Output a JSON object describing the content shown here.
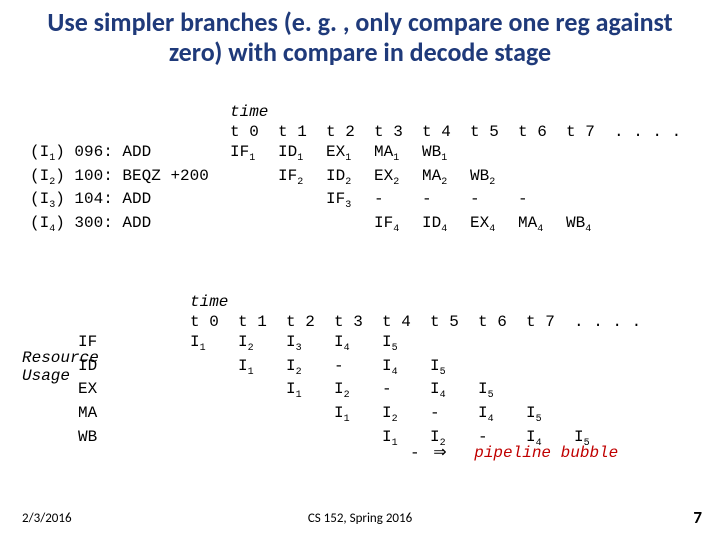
{
  "title": "Use simpler branches (e. g. , only compare one reg against zero) with compare in decode stage",
  "pipeline": {
    "time_label": "time",
    "headers": [
      "t 0",
      "t 1",
      "t 2",
      "t 3",
      "t 4",
      "t 5",
      "t 6",
      "t 7",
      ". . . ."
    ],
    "rows": [
      {
        "instr": "(I",
        "sub": "1",
        "rest": ") 096: ADD",
        "cells": [
          "IF",
          "ID",
          "EX",
          "MA",
          "WB",
          "",
          "",
          ""
        ],
        "subs": [
          "1",
          "1",
          "1",
          "1",
          "1",
          "",
          "",
          ""
        ]
      },
      {
        "instr": "(I",
        "sub": "2",
        "rest": ") 100: BEQZ +200",
        "cells": [
          "",
          "IF",
          "ID",
          "EX",
          "MA",
          "WB",
          "",
          ""
        ],
        "subs": [
          "",
          "2",
          "2",
          "2",
          "2",
          "2",
          "",
          ""
        ]
      },
      {
        "instr": "(I",
        "sub": "3",
        "rest": ") 104: ADD",
        "cells": [
          "",
          "",
          "IF",
          "-",
          "-",
          "-",
          "-",
          ""
        ],
        "subs": [
          "",
          "",
          "3",
          "",
          "",
          "",
          "",
          ""
        ]
      },
      {
        "instr": "(I",
        "sub": "4",
        "rest": ") 300: ADD",
        "cells": [
          "",
          "",
          "",
          "IF",
          "ID",
          "EX",
          "MA",
          "WB"
        ],
        "subs": [
          "",
          "",
          "",
          "4",
          "4",
          "4",
          "4",
          "4"
        ]
      }
    ]
  },
  "resource": {
    "time_label": "time",
    "headers": [
      "t 0",
      "t 1",
      "t 2",
      "t 3",
      "t 4",
      "t 5",
      "t 6",
      "t 7",
      ". . . ."
    ],
    "label": "Resource\nUsage",
    "stages": [
      "IF",
      "ID",
      "EX",
      "MA",
      "WB"
    ],
    "grid": [
      [
        "I",
        "I",
        "I",
        "I",
        "I",
        "",
        "",
        ""
      ],
      [
        "",
        "I",
        "I",
        "-",
        "I",
        "I",
        "",
        ""
      ],
      [
        "",
        "",
        "I",
        "I",
        "-",
        "I",
        "I",
        ""
      ],
      [
        "",
        "",
        "",
        "I",
        "I",
        "-",
        "I",
        "I"
      ],
      [
        "",
        "",
        "",
        "",
        "I",
        "I",
        "-",
        "I",
        "I"
      ]
    ],
    "gridsubs": [
      [
        "1",
        "2",
        "3",
        "4",
        "5",
        "",
        "",
        ""
      ],
      [
        "",
        "1",
        "2",
        "",
        "4",
        "5",
        "",
        ""
      ],
      [
        "",
        "",
        "1",
        "2",
        "",
        "4",
        "5",
        ""
      ],
      [
        "",
        "",
        "",
        "1",
        "2",
        "",
        "4",
        "5"
      ],
      [
        "",
        "",
        "",
        "",
        "1",
        "2",
        "",
        "4",
        "5"
      ]
    ]
  },
  "bubble": {
    "dash": "- ",
    "arrow": "⇒",
    "label": "pipeline bubble"
  },
  "footer": {
    "date": "2/3/2016",
    "course": "CS 152, Spring 2016",
    "page": "7"
  }
}
